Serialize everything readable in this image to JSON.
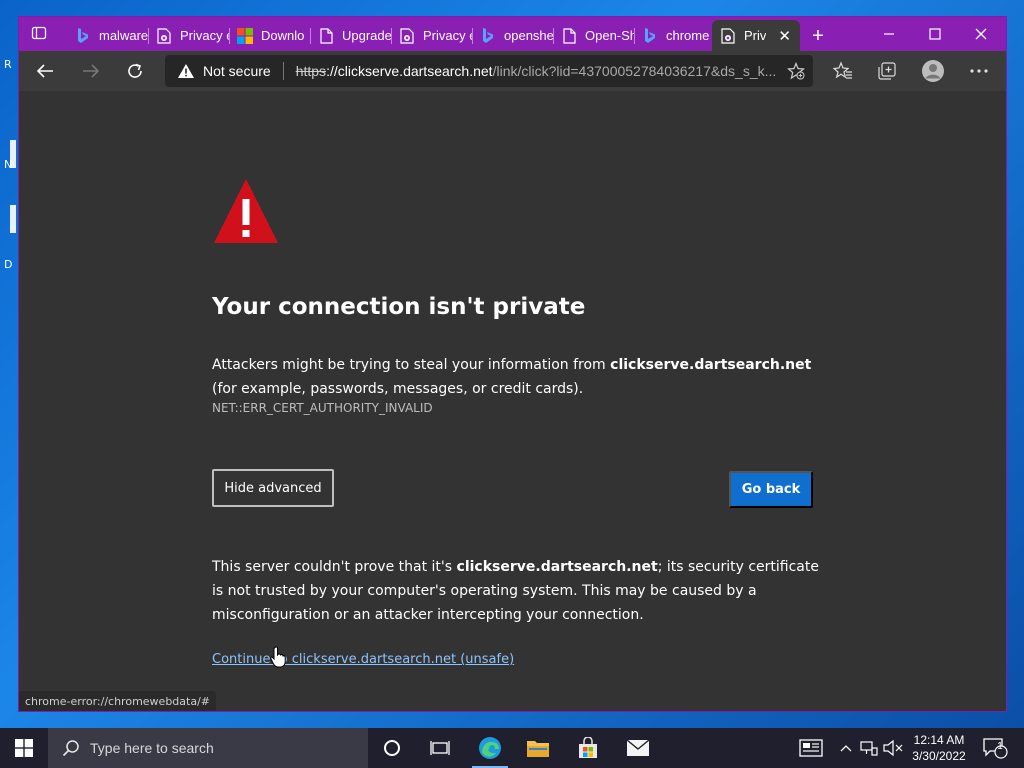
{
  "browser": {
    "tabs": [
      {
        "label": "malware",
        "icon": "bing-icon"
      },
      {
        "label": "Privacy e",
        "icon": "error-page-icon"
      },
      {
        "label": "Downlo",
        "icon": "microsoft-icon"
      },
      {
        "label": "Upgrade",
        "icon": "page-icon"
      },
      {
        "label": "Privacy e",
        "icon": "error-page-icon"
      },
      {
        "label": "openshe",
        "icon": "bing-icon"
      },
      {
        "label": "Open-Sh",
        "icon": "page-icon"
      },
      {
        "label": "chrome",
        "icon": "bing-icon"
      },
      {
        "label": "Priv",
        "icon": "error-page-icon",
        "active": true
      }
    ],
    "new_tab": "+",
    "address": {
      "security_label": "Not secure",
      "url_scheme": "https",
      "url_host": "://clickserve.dartsearch.net",
      "url_path": "/link/click?lid=43700052784036217&ds_s_k..."
    }
  },
  "page": {
    "heading": "Your connection isn't private",
    "intro_pre": "Attackers might be trying to steal your information from ",
    "intro_host": "clickserve.dartsearch.net",
    "intro_post": " (for example, passwords, messages, or credit cards).",
    "error_code": "NET::ERR_CERT_AUTHORITY_INVALID",
    "hide_advanced": "Hide advanced",
    "go_back": "Go back",
    "detail_pre": "This server couldn't prove that it's ",
    "detail_host": "clickserve.dartsearch.net",
    "detail_post": "; its security certificate is not trusted by your computer's operating system. This may be caused by a misconfiguration or an attacker intercepting your connection.",
    "continue_link": "Continue to clickserve.dartsearch.net (unsafe)",
    "status_url": "chrome-error://chromewebdata/#"
  },
  "desktop": {
    "fragments": [
      "R",
      "N",
      "D"
    ]
  },
  "taskbar": {
    "search_placeholder": "Type here to search",
    "time": "12:14 AM",
    "date": "3/30/2022",
    "notification_count": "1"
  },
  "colors": {
    "titlebar": "#8a1fb4",
    "page_bg": "#333333",
    "primary_button": "#0f6fce",
    "warning": "#d0101b",
    "link": "#8cc4ff"
  }
}
